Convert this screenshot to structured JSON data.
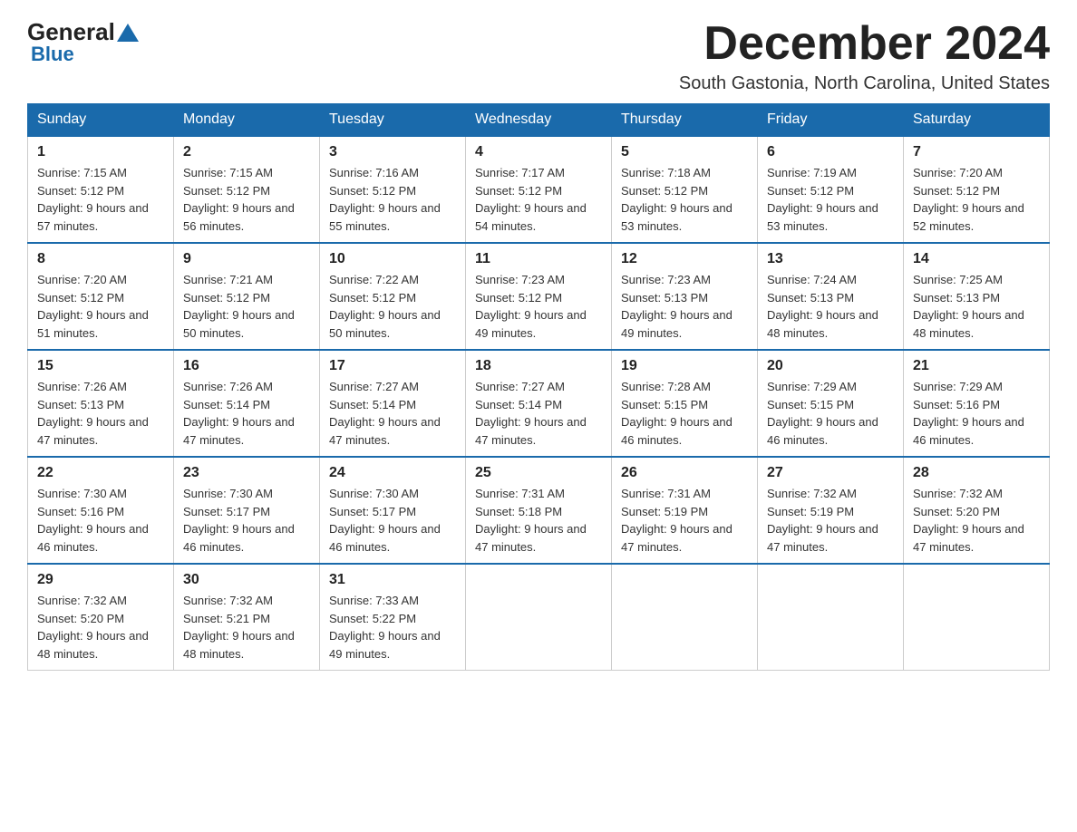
{
  "logo": {
    "text1": "General",
    "text2": "Blue"
  },
  "header": {
    "month_year": "December 2024",
    "location": "South Gastonia, North Carolina, United States"
  },
  "days_of_week": [
    "Sunday",
    "Monday",
    "Tuesday",
    "Wednesday",
    "Thursday",
    "Friday",
    "Saturday"
  ],
  "weeks": [
    [
      {
        "day": "1",
        "sunrise": "Sunrise: 7:15 AM",
        "sunset": "Sunset: 5:12 PM",
        "daylight": "Daylight: 9 hours and 57 minutes."
      },
      {
        "day": "2",
        "sunrise": "Sunrise: 7:15 AM",
        "sunset": "Sunset: 5:12 PM",
        "daylight": "Daylight: 9 hours and 56 minutes."
      },
      {
        "day": "3",
        "sunrise": "Sunrise: 7:16 AM",
        "sunset": "Sunset: 5:12 PM",
        "daylight": "Daylight: 9 hours and 55 minutes."
      },
      {
        "day": "4",
        "sunrise": "Sunrise: 7:17 AM",
        "sunset": "Sunset: 5:12 PM",
        "daylight": "Daylight: 9 hours and 54 minutes."
      },
      {
        "day": "5",
        "sunrise": "Sunrise: 7:18 AM",
        "sunset": "Sunset: 5:12 PM",
        "daylight": "Daylight: 9 hours and 53 minutes."
      },
      {
        "day": "6",
        "sunrise": "Sunrise: 7:19 AM",
        "sunset": "Sunset: 5:12 PM",
        "daylight": "Daylight: 9 hours and 53 minutes."
      },
      {
        "day": "7",
        "sunrise": "Sunrise: 7:20 AM",
        "sunset": "Sunset: 5:12 PM",
        "daylight": "Daylight: 9 hours and 52 minutes."
      }
    ],
    [
      {
        "day": "8",
        "sunrise": "Sunrise: 7:20 AM",
        "sunset": "Sunset: 5:12 PM",
        "daylight": "Daylight: 9 hours and 51 minutes."
      },
      {
        "day": "9",
        "sunrise": "Sunrise: 7:21 AM",
        "sunset": "Sunset: 5:12 PM",
        "daylight": "Daylight: 9 hours and 50 minutes."
      },
      {
        "day": "10",
        "sunrise": "Sunrise: 7:22 AM",
        "sunset": "Sunset: 5:12 PM",
        "daylight": "Daylight: 9 hours and 50 minutes."
      },
      {
        "day": "11",
        "sunrise": "Sunrise: 7:23 AM",
        "sunset": "Sunset: 5:12 PM",
        "daylight": "Daylight: 9 hours and 49 minutes."
      },
      {
        "day": "12",
        "sunrise": "Sunrise: 7:23 AM",
        "sunset": "Sunset: 5:13 PM",
        "daylight": "Daylight: 9 hours and 49 minutes."
      },
      {
        "day": "13",
        "sunrise": "Sunrise: 7:24 AM",
        "sunset": "Sunset: 5:13 PM",
        "daylight": "Daylight: 9 hours and 48 minutes."
      },
      {
        "day": "14",
        "sunrise": "Sunrise: 7:25 AM",
        "sunset": "Sunset: 5:13 PM",
        "daylight": "Daylight: 9 hours and 48 minutes."
      }
    ],
    [
      {
        "day": "15",
        "sunrise": "Sunrise: 7:26 AM",
        "sunset": "Sunset: 5:13 PM",
        "daylight": "Daylight: 9 hours and 47 minutes."
      },
      {
        "day": "16",
        "sunrise": "Sunrise: 7:26 AM",
        "sunset": "Sunset: 5:14 PM",
        "daylight": "Daylight: 9 hours and 47 minutes."
      },
      {
        "day": "17",
        "sunrise": "Sunrise: 7:27 AM",
        "sunset": "Sunset: 5:14 PM",
        "daylight": "Daylight: 9 hours and 47 minutes."
      },
      {
        "day": "18",
        "sunrise": "Sunrise: 7:27 AM",
        "sunset": "Sunset: 5:14 PM",
        "daylight": "Daylight: 9 hours and 47 minutes."
      },
      {
        "day": "19",
        "sunrise": "Sunrise: 7:28 AM",
        "sunset": "Sunset: 5:15 PM",
        "daylight": "Daylight: 9 hours and 46 minutes."
      },
      {
        "day": "20",
        "sunrise": "Sunrise: 7:29 AM",
        "sunset": "Sunset: 5:15 PM",
        "daylight": "Daylight: 9 hours and 46 minutes."
      },
      {
        "day": "21",
        "sunrise": "Sunrise: 7:29 AM",
        "sunset": "Sunset: 5:16 PM",
        "daylight": "Daylight: 9 hours and 46 minutes."
      }
    ],
    [
      {
        "day": "22",
        "sunrise": "Sunrise: 7:30 AM",
        "sunset": "Sunset: 5:16 PM",
        "daylight": "Daylight: 9 hours and 46 minutes."
      },
      {
        "day": "23",
        "sunrise": "Sunrise: 7:30 AM",
        "sunset": "Sunset: 5:17 PM",
        "daylight": "Daylight: 9 hours and 46 minutes."
      },
      {
        "day": "24",
        "sunrise": "Sunrise: 7:30 AM",
        "sunset": "Sunset: 5:17 PM",
        "daylight": "Daylight: 9 hours and 46 minutes."
      },
      {
        "day": "25",
        "sunrise": "Sunrise: 7:31 AM",
        "sunset": "Sunset: 5:18 PM",
        "daylight": "Daylight: 9 hours and 47 minutes."
      },
      {
        "day": "26",
        "sunrise": "Sunrise: 7:31 AM",
        "sunset": "Sunset: 5:19 PM",
        "daylight": "Daylight: 9 hours and 47 minutes."
      },
      {
        "day": "27",
        "sunrise": "Sunrise: 7:32 AM",
        "sunset": "Sunset: 5:19 PM",
        "daylight": "Daylight: 9 hours and 47 minutes."
      },
      {
        "day": "28",
        "sunrise": "Sunrise: 7:32 AM",
        "sunset": "Sunset: 5:20 PM",
        "daylight": "Daylight: 9 hours and 47 minutes."
      }
    ],
    [
      {
        "day": "29",
        "sunrise": "Sunrise: 7:32 AM",
        "sunset": "Sunset: 5:20 PM",
        "daylight": "Daylight: 9 hours and 48 minutes."
      },
      {
        "day": "30",
        "sunrise": "Sunrise: 7:32 AM",
        "sunset": "Sunset: 5:21 PM",
        "daylight": "Daylight: 9 hours and 48 minutes."
      },
      {
        "day": "31",
        "sunrise": "Sunrise: 7:33 AM",
        "sunset": "Sunset: 5:22 PM",
        "daylight": "Daylight: 9 hours and 49 minutes."
      },
      {
        "day": "",
        "sunrise": "",
        "sunset": "",
        "daylight": ""
      },
      {
        "day": "",
        "sunrise": "",
        "sunset": "",
        "daylight": ""
      },
      {
        "day": "",
        "sunrise": "",
        "sunset": "",
        "daylight": ""
      },
      {
        "day": "",
        "sunrise": "",
        "sunset": "",
        "daylight": ""
      }
    ]
  ]
}
